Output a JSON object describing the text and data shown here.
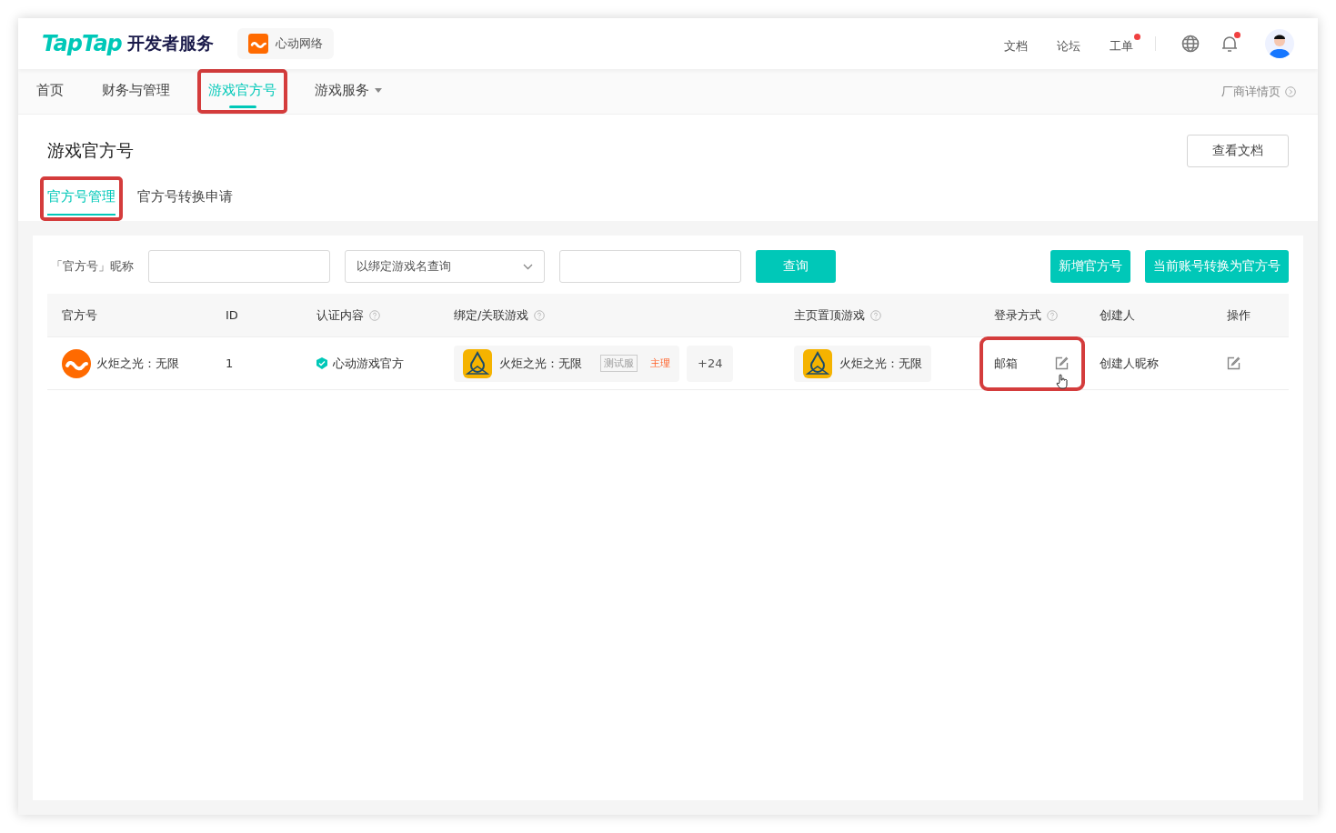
{
  "header": {
    "logo": "TapTap",
    "logo_suffix": "开发者服务",
    "org": "心动网络",
    "links": [
      {
        "label": "文档",
        "badge": false
      },
      {
        "label": "论坛",
        "badge": false
      },
      {
        "label": "工单",
        "badge": true
      }
    ],
    "bell_badge": true
  },
  "nav": {
    "items": [
      {
        "label": "首页",
        "selected": false,
        "highlighted": false,
        "dropdown": false
      },
      {
        "label": "财务与管理",
        "selected": false,
        "highlighted": false,
        "dropdown": false
      },
      {
        "label": "游戏官方号",
        "selected": true,
        "highlighted": true,
        "dropdown": false
      },
      {
        "label": "游戏服务",
        "selected": false,
        "highlighted": false,
        "dropdown": true
      }
    ],
    "right_link": "厂商详情页"
  },
  "page": {
    "title": "游戏官方号",
    "doc_button": "查看文档",
    "tabs": [
      {
        "label": "官方号管理",
        "selected": true,
        "highlighted": true
      },
      {
        "label": "官方号转换申请",
        "selected": false,
        "highlighted": false
      }
    ]
  },
  "filters": {
    "nickname_label": "「官方号」昵称",
    "select_placeholder": "以绑定游戏名查询",
    "search_button": "查询",
    "buttons": [
      "新增官方号",
      "当前账号转换为官方号"
    ]
  },
  "table": {
    "columns": [
      {
        "label": "官方号",
        "help": false
      },
      {
        "label": "ID",
        "help": false
      },
      {
        "label": "认证内容",
        "help": true
      },
      {
        "label": "绑定/关联游戏",
        "help": true
      },
      {
        "label": "主页置顶游戏",
        "help": true
      },
      {
        "label": "登录方式",
        "help": true
      },
      {
        "label": "创建人",
        "help": false
      },
      {
        "label": "操作",
        "help": false
      }
    ],
    "rows": [
      {
        "name": "火炬之光：无限",
        "id": "1",
        "verified": "心动游戏官方",
        "bound_game": "火炬之光：无限",
        "test_tag": "测试服",
        "main_tag": "主理",
        "more": "+24",
        "pinned_game": "火炬之光：无限",
        "login": "邮箱",
        "login_highlighted": true,
        "creator": "创建人昵称"
      }
    ]
  }
}
